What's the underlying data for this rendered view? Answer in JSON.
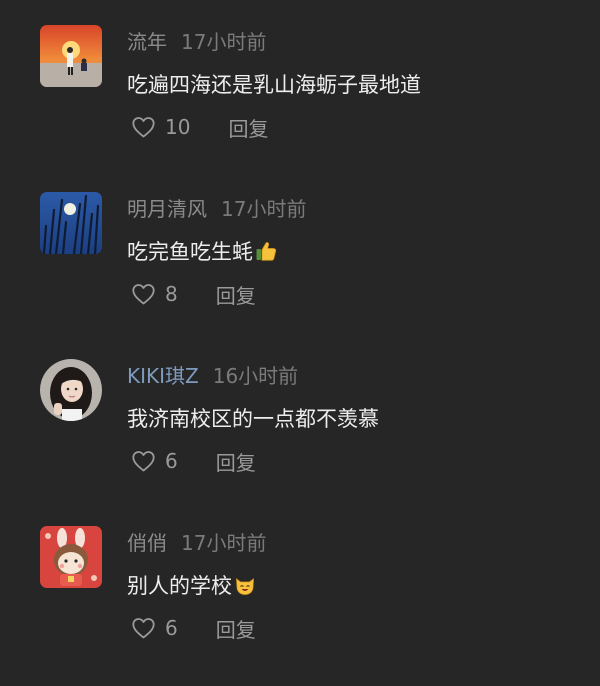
{
  "comments": [
    {
      "username": "流年",
      "time": "17小时前",
      "text": "吃遍四海还是乳山海蛎子最地道",
      "likes": "10",
      "reply_label": "回复",
      "avatar_icon": "sunset-avatar"
    },
    {
      "username": "明月清风",
      "time": "17小时前",
      "text": "吃完鱼吃生蚝",
      "emoji": "thumbs-up-icon",
      "likes": "8",
      "reply_label": "回复",
      "avatar_icon": "moon-avatar"
    },
    {
      "username": "KIKI琪Z",
      "time": "16小时前",
      "text": "我济南校区的一点都不羡慕",
      "likes": "6",
      "reply_label": "回复",
      "avatar_icon": "girl-avatar"
    },
    {
      "username": "俏俏",
      "time": "17小时前",
      "text": "别人的学校",
      "emoji": "smiling-cat-icon",
      "likes": "6",
      "reply_label": "回复",
      "avatar_icon": "bunny-avatar"
    }
  ],
  "colors": {
    "background": "#262626",
    "username": "#8a8a8a",
    "username_highlight": "#7e9bbd",
    "text": "#ededed",
    "muted": "#9a9a9a"
  }
}
